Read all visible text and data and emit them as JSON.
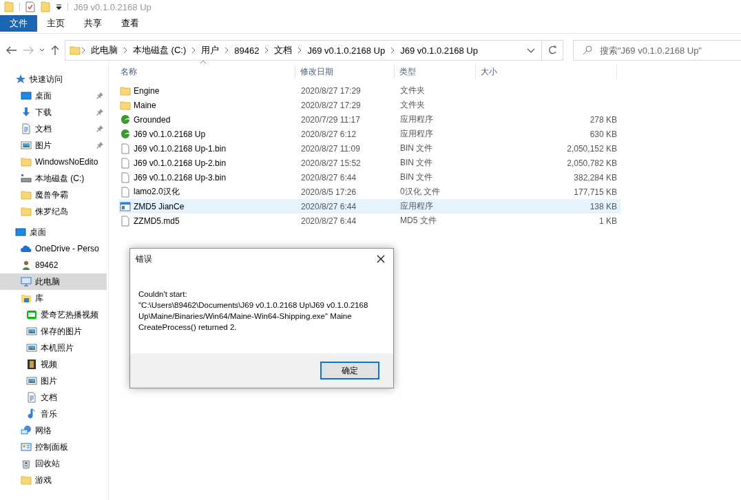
{
  "title_bar": {
    "title": "J69 v0.1.0.2168 Up"
  },
  "ribbon_tabs": [
    {
      "label": "文件",
      "selected": true
    },
    {
      "label": "主页",
      "selected": false
    },
    {
      "label": "共享",
      "selected": false
    },
    {
      "label": "查看",
      "selected": false
    }
  ],
  "address_bar": {
    "crumbs": [
      "此电脑",
      "本地磁盘 (C:)",
      "用户",
      "89462",
      "文档",
      "J69 v0.1.0.2168 Up",
      "J69 v0.1.0.2168 Up"
    ]
  },
  "search": {
    "placeholder": "搜索\"J69 v0.1.0.2168 Up\""
  },
  "sidebar": {
    "items": [
      {
        "label": "快速访问",
        "kind": "star",
        "selected": false,
        "children": [
          {
            "label": "桌面",
            "kind": "desktop",
            "selected": false,
            "pinned": true
          },
          {
            "label": "下载",
            "kind": "download",
            "selected": false,
            "pinned": true
          },
          {
            "label": "文档",
            "kind": "document",
            "selected": false,
            "pinned": true
          },
          {
            "label": "图片",
            "kind": "pictures",
            "selected": false,
            "pinned": true
          },
          {
            "label": "WindowsNoEdito",
            "kind": "folder",
            "selected": false,
            "pinned": false
          },
          {
            "label": "本地磁盘 (C:)",
            "kind": "drive",
            "selected": false,
            "pinned": false
          },
          {
            "label": "魔兽争霸",
            "kind": "folder",
            "selected": false,
            "pinned": false
          },
          {
            "label": "侏罗纪岛",
            "kind": "folder",
            "selected": false,
            "pinned": false
          }
        ]
      },
      {
        "label": "桌面",
        "kind": "desktop",
        "selected": false,
        "children": [
          {
            "label": "OneDrive - Perso",
            "kind": "cloud",
            "selected": false
          },
          {
            "label": "89462",
            "kind": "user",
            "selected": false
          },
          {
            "label": "此电脑",
            "kind": "computer",
            "selected": true
          },
          {
            "label": "库",
            "kind": "library",
            "selected": false,
            "children": [
              {
                "label": "爱奇艺热播视频",
                "kind": "player",
                "selected": false
              },
              {
                "label": "保存的图片",
                "kind": "pictures",
                "selected": false
              },
              {
                "label": "本机照片",
                "kind": "pictures",
                "selected": false
              },
              {
                "label": "视频",
                "kind": "video",
                "selected": false
              },
              {
                "label": "图片",
                "kind": "pictures",
                "selected": false
              },
              {
                "label": "文档",
                "kind": "document",
                "selected": false
              },
              {
                "label": "音乐",
                "kind": "music",
                "selected": false
              }
            ]
          },
          {
            "label": "网络",
            "kind": "network",
            "selected": false
          },
          {
            "label": "控制面板",
            "kind": "control-panel",
            "selected": false
          },
          {
            "label": "回收站",
            "kind": "recycle",
            "selected": false
          },
          {
            "label": "游戏",
            "kind": "folder",
            "selected": false
          }
        ]
      }
    ]
  },
  "file_list": {
    "columns": [
      {
        "label": "名称",
        "sorted": true
      },
      {
        "label": "修改日期",
        "sorted": false
      },
      {
        "label": "类型",
        "sorted": false
      },
      {
        "label": "大小",
        "sorted": false
      }
    ],
    "rows": [
      {
        "name": "Engine",
        "kind": "folder",
        "date": "2020/8/27 17:29",
        "type": "文件夹",
        "selected": false
      },
      {
        "name": "Maine",
        "kind": "folder",
        "date": "2020/8/27 17:29",
        "type": "文件夹",
        "selected": false
      },
      {
        "name": "Grounded",
        "kind": "leaf-app",
        "date": "2020/7/29 11:17",
        "type": "应用程序",
        "size": "278 KB",
        "selected": false
      },
      {
        "name": "J69 v0.1.0.2168 Up",
        "kind": "leaf-app",
        "date": "2020/8/27 6:12",
        "type": "应用程序",
        "size": "630 KB",
        "selected": false
      },
      {
        "name": "J69 v0.1.0.2168 Up-1.bin",
        "kind": "file",
        "date": "2020/8/27 11:09",
        "type": "BIN 文件",
        "size": "2,050,152 KB",
        "selected": false
      },
      {
        "name": "J69 v0.1.0.2168 Up-2.bin",
        "kind": "file",
        "date": "2020/8/27 15:52",
        "type": "BIN 文件",
        "size": "2,050,782 KB",
        "selected": false
      },
      {
        "name": "J69 v0.1.0.2168 Up-3.bin",
        "kind": "file",
        "date": "2020/8/27 6:44",
        "type": "BIN 文件",
        "size": "382,284 KB",
        "selected": false
      },
      {
        "name": "lamo2.0汉化",
        "kind": "file",
        "date": "2020/8/5 17:26",
        "type": "0汉化 文件",
        "size": "177,715 KB",
        "selected": false
      },
      {
        "name": "ZMD5 JianCe",
        "kind": "window-app",
        "date": "2020/8/27 6:44",
        "type": "应用程序",
        "size": "138 KB",
        "selected": true
      },
      {
        "name": "ZZMD5.md5",
        "kind": "file",
        "date": "2020/8/27 6:44",
        "type": "MD5 文件",
        "size": "1 KB",
        "selected": false
      }
    ]
  },
  "dialog": {
    "title": "错误",
    "message": "Couldn't start:\n\"C:\\Users\\89462\\Documents\\J69 v0.1.0.2168 Up\\J69 v0.1.0.2168\nUp\\Maine/Binaries/Win64/Maine-Win64-Shipping.exe\" Maine\nCreateProcess() returned 2.",
    "buttons": [
      {
        "label": "确定",
        "focused": true
      }
    ]
  }
}
